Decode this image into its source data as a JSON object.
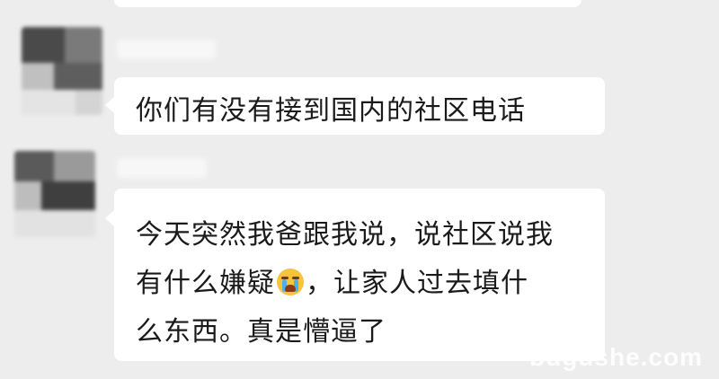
{
  "chat": {
    "messages": [
      {
        "text": "你们有没有接到国内的社区电话"
      },
      {
        "line1": "今天突然我爸跟我说，说社区说我",
        "line2_before": "有什么嫌疑",
        "line2_after": "，让家人过去填什",
        "line3": "么东西。真是懵逼了",
        "emoji": "crying-face-icon"
      }
    ]
  },
  "colors": {
    "background": "#ededed",
    "bubble": "#ffffff",
    "text": "#1a1a1a"
  },
  "watermark": "bugushe.com"
}
